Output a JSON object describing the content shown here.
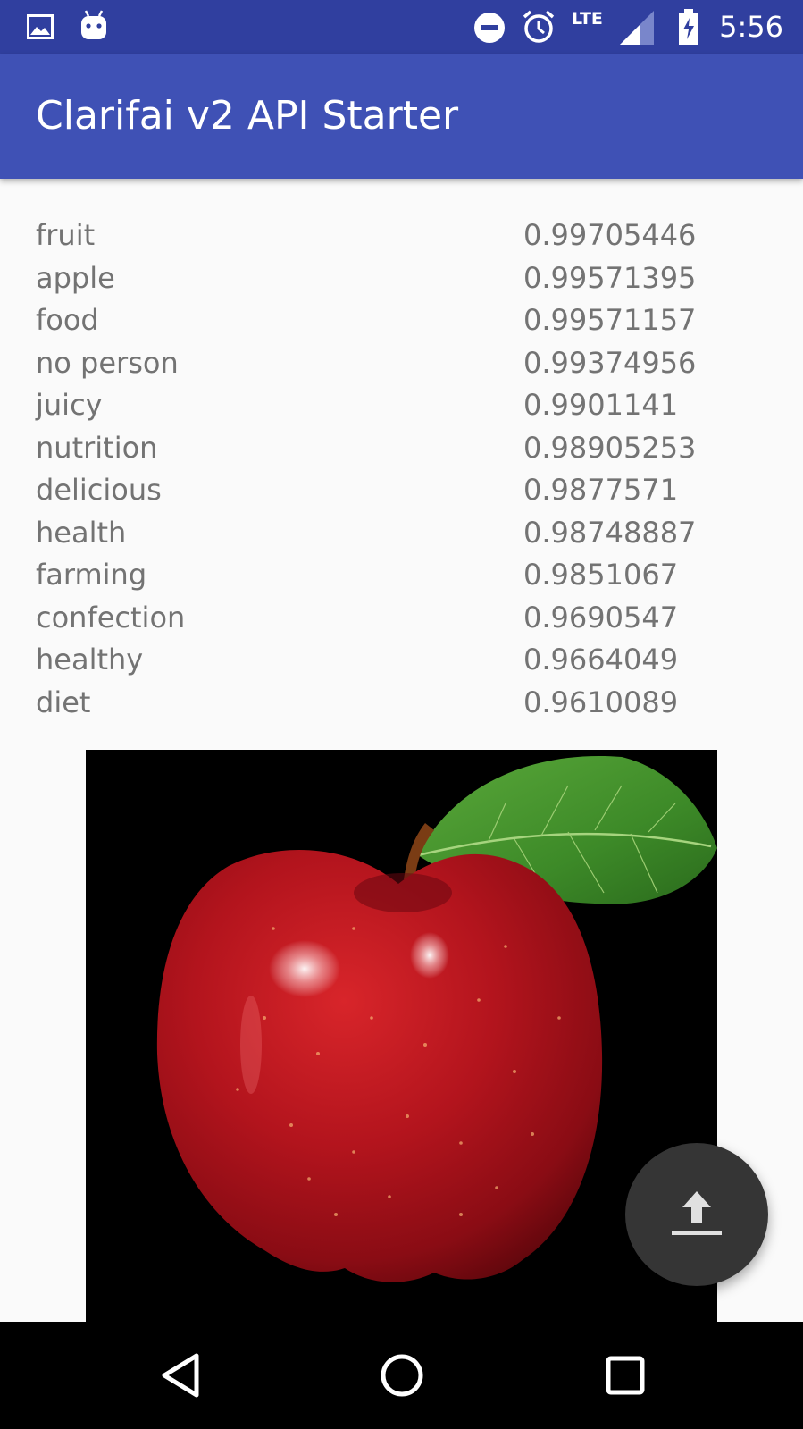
{
  "status_bar": {
    "time": "5:56",
    "network": "LTE",
    "icons": [
      "image-notification-icon",
      "android-notification-icon",
      "do-not-disturb-icon",
      "alarm-icon",
      "signal-icon",
      "battery-charging-icon"
    ]
  },
  "app_bar": {
    "title": "Clarifai v2 API Starter",
    "color": "#3f51b5",
    "status_color": "#303f9f"
  },
  "predictions": [
    {
      "label": "fruit",
      "score": "0.99705446"
    },
    {
      "label": "apple",
      "score": "0.99571395"
    },
    {
      "label": "food",
      "score": "0.99571157"
    },
    {
      "label": "no person",
      "score": "0.99374956"
    },
    {
      "label": "juicy",
      "score": "0.9901141"
    },
    {
      "label": "nutrition",
      "score": "0.98905253"
    },
    {
      "label": "delicious",
      "score": "0.9877571"
    },
    {
      "label": "health",
      "score": "0.98748887"
    },
    {
      "label": "farming",
      "score": "0.9851067"
    },
    {
      "label": "confection",
      "score": "0.9690547"
    },
    {
      "label": "healthy",
      "score": "0.9664049"
    },
    {
      "label": "diet",
      "score": "0.9610089"
    }
  ],
  "image": {
    "subject": "apple-image"
  },
  "fab": {
    "icon": "upload-icon",
    "color": "#353535"
  },
  "nav_bar": {
    "icons": [
      "back-icon",
      "home-icon",
      "recents-icon"
    ]
  }
}
